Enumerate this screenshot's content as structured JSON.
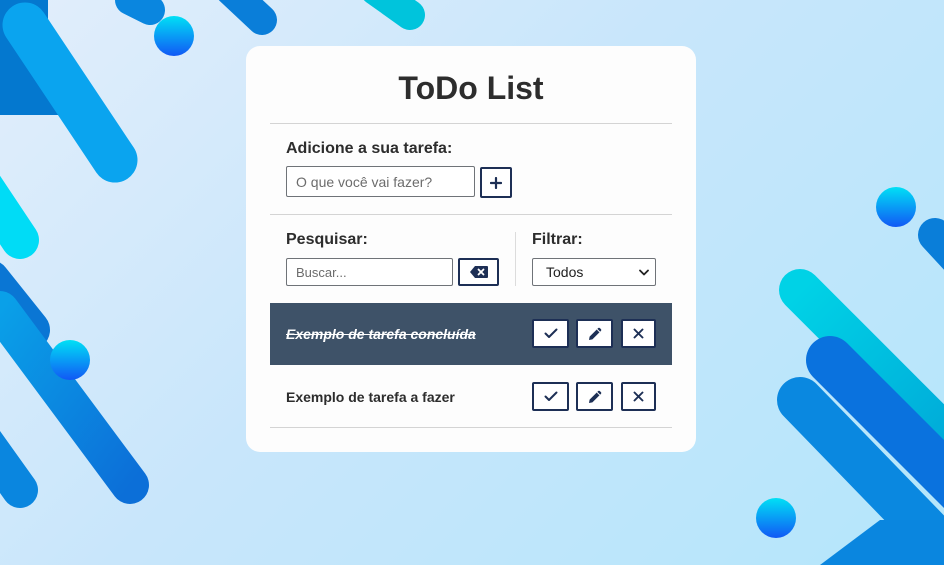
{
  "app": {
    "title": "ToDo List"
  },
  "add": {
    "label": "Adicione a sua tarefa:",
    "input_placeholder": "O que você vai fazer?",
    "input_value": "",
    "button_icon": "plus-icon"
  },
  "search": {
    "label": "Pesquisar:",
    "input_placeholder": "Buscar...",
    "input_value": "",
    "clear_icon": "backspace-icon"
  },
  "filter": {
    "label": "Filtrar:",
    "selected": "Todos",
    "icon": "chevron-down-icon"
  },
  "todos": [
    {
      "text": "Exemplo de tarefa concluída",
      "done": true,
      "actions": [
        "check-icon",
        "pencil-icon",
        "close-icon"
      ]
    },
    {
      "text": "Exemplo de tarefa a fazer",
      "done": false,
      "actions": [
        "check-icon",
        "pencil-icon",
        "close-icon"
      ]
    }
  ],
  "colors": {
    "accent": "#1d2f55",
    "done_row_bg": "#3e5268",
    "card_bg": "#fdfdfd",
    "background_light": "#c8e6fb",
    "blob_blue": "#0587da",
    "blob_cyan": "#00c0d8",
    "circle_top": "#00e0f5",
    "circle_bottom": "#1158f5"
  }
}
